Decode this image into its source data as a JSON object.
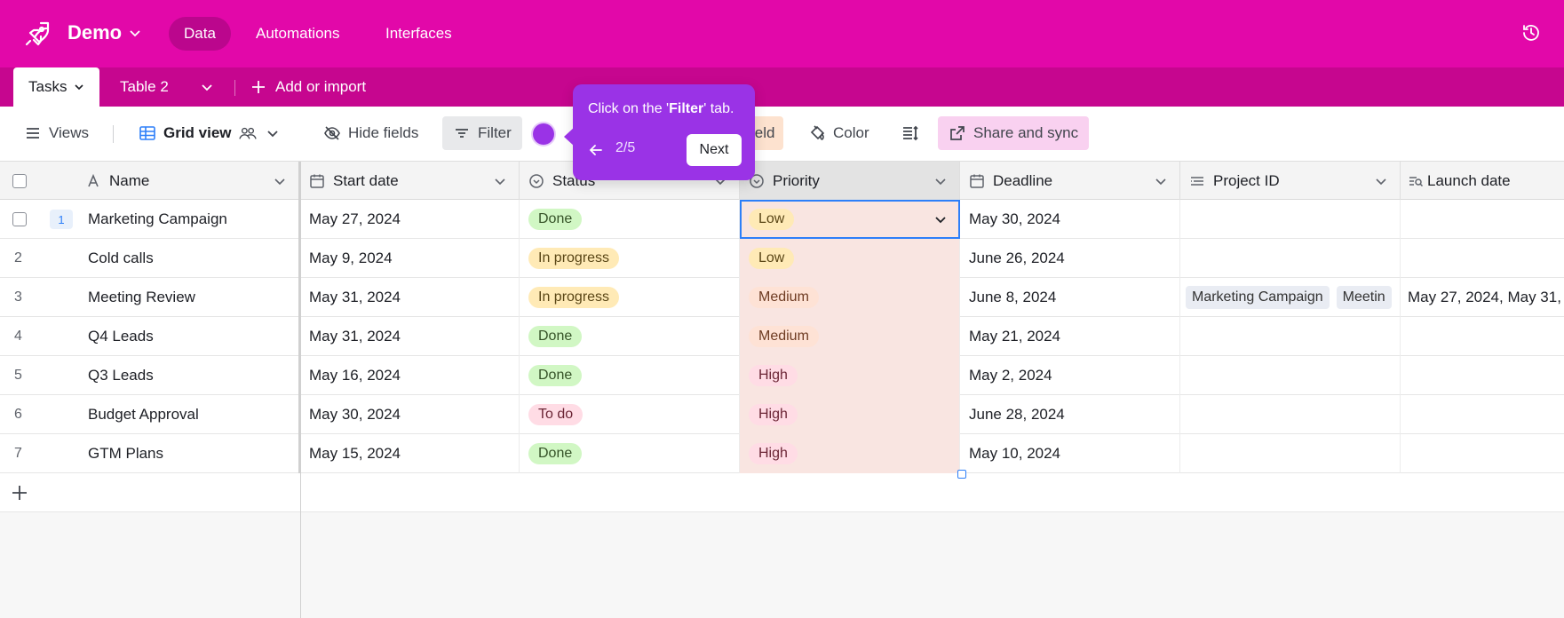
{
  "app": {
    "base_name": "Demo",
    "nav": {
      "data": "Data",
      "automations": "Automations",
      "interfaces": "Interfaces"
    }
  },
  "tabs": {
    "active": "Tasks",
    "second": "Table 2",
    "add": "Add or import"
  },
  "toolbar": {
    "views": "Views",
    "grid_view": "Grid view",
    "hide_fields": "Hide fields",
    "filter": "Filter",
    "field_partial": "ield",
    "color": "Color",
    "share": "Share and sync"
  },
  "columns": {
    "name": "Name",
    "start_date": "Start date",
    "status": "Status",
    "priority": "Priority",
    "deadline": "Deadline",
    "project_id": "Project ID",
    "launch_date": "Launch date"
  },
  "rows": [
    {
      "num": "1",
      "name": "Marketing Campaign",
      "start": "May 27, 2024",
      "status": "Done",
      "priority": "Low",
      "deadline": "May 30, 2024"
    },
    {
      "num": "2",
      "name": "Cold calls",
      "start": "May 9, 2024",
      "status": "In progress",
      "priority": "Low",
      "deadline": "June 26, 2024"
    },
    {
      "num": "3",
      "name": "Meeting Review",
      "start": "May 31, 2024",
      "status": "In progress",
      "priority": "Medium",
      "deadline": "June 8, 2024",
      "project_links": [
        "Marketing Campaign",
        "Meetin"
      ],
      "launch": "May 27, 2024, May 31,"
    },
    {
      "num": "4",
      "name": "Q4 Leads",
      "start": "May 31, 2024",
      "status": "Done",
      "priority": "Medium",
      "deadline": "May 21, 2024"
    },
    {
      "num": "5",
      "name": "Q3 Leads",
      "start": "May 16, 2024",
      "status": "Done",
      "priority": "High",
      "deadline": "May 2, 2024"
    },
    {
      "num": "6",
      "name": "Budget Approval",
      "start": "May 30, 2024",
      "status": "To do",
      "priority": "High",
      "deadline": "June 28, 2024"
    },
    {
      "num": "7",
      "name": "GTM Plans",
      "start": "May 15, 2024",
      "status": "Done",
      "priority": "High",
      "deadline": "May 10, 2024"
    }
  ],
  "tooltip": {
    "prefix": "Click on the '",
    "highlight": "Filter",
    "suffix": "' tab.",
    "step": "2/5",
    "next": "Next"
  },
  "colors": {
    "brand": "#e208a9",
    "tabs_bar": "#c6068f",
    "tooltip": "#9a33e6",
    "selection": "#2d7ff9"
  }
}
